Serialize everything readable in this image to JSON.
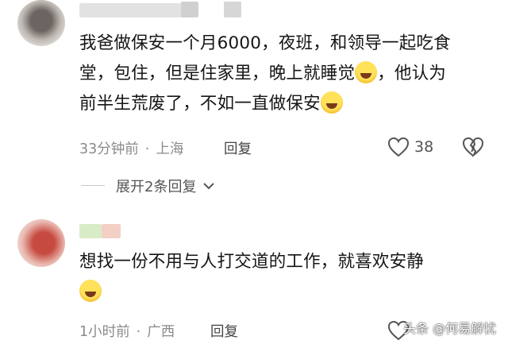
{
  "comments": [
    {
      "text_line1": "我爸做保安一个月6000，夜班，和领导一起吃食",
      "text_line2a": "堂，包住，但是住家里，晚上就睡觉",
      "text_line2b": "，他认为",
      "text_line3": "前半生荒废了，不如一直做保安",
      "time": "33分钟前",
      "location": "上海",
      "reply_label": "回复",
      "likes": "38",
      "expand_label": "展开2条回复"
    },
    {
      "text_line1": "想找一份不用与人打交道的工作，就喜欢安静",
      "time": "1小时前",
      "location": "广西",
      "reply_label": "回复"
    }
  ],
  "separator": "·",
  "watermark": "头条 @何易解忧",
  "colors": {
    "text": "#151515",
    "meta": "#8b8b8b",
    "emoji": "#f4b620"
  }
}
